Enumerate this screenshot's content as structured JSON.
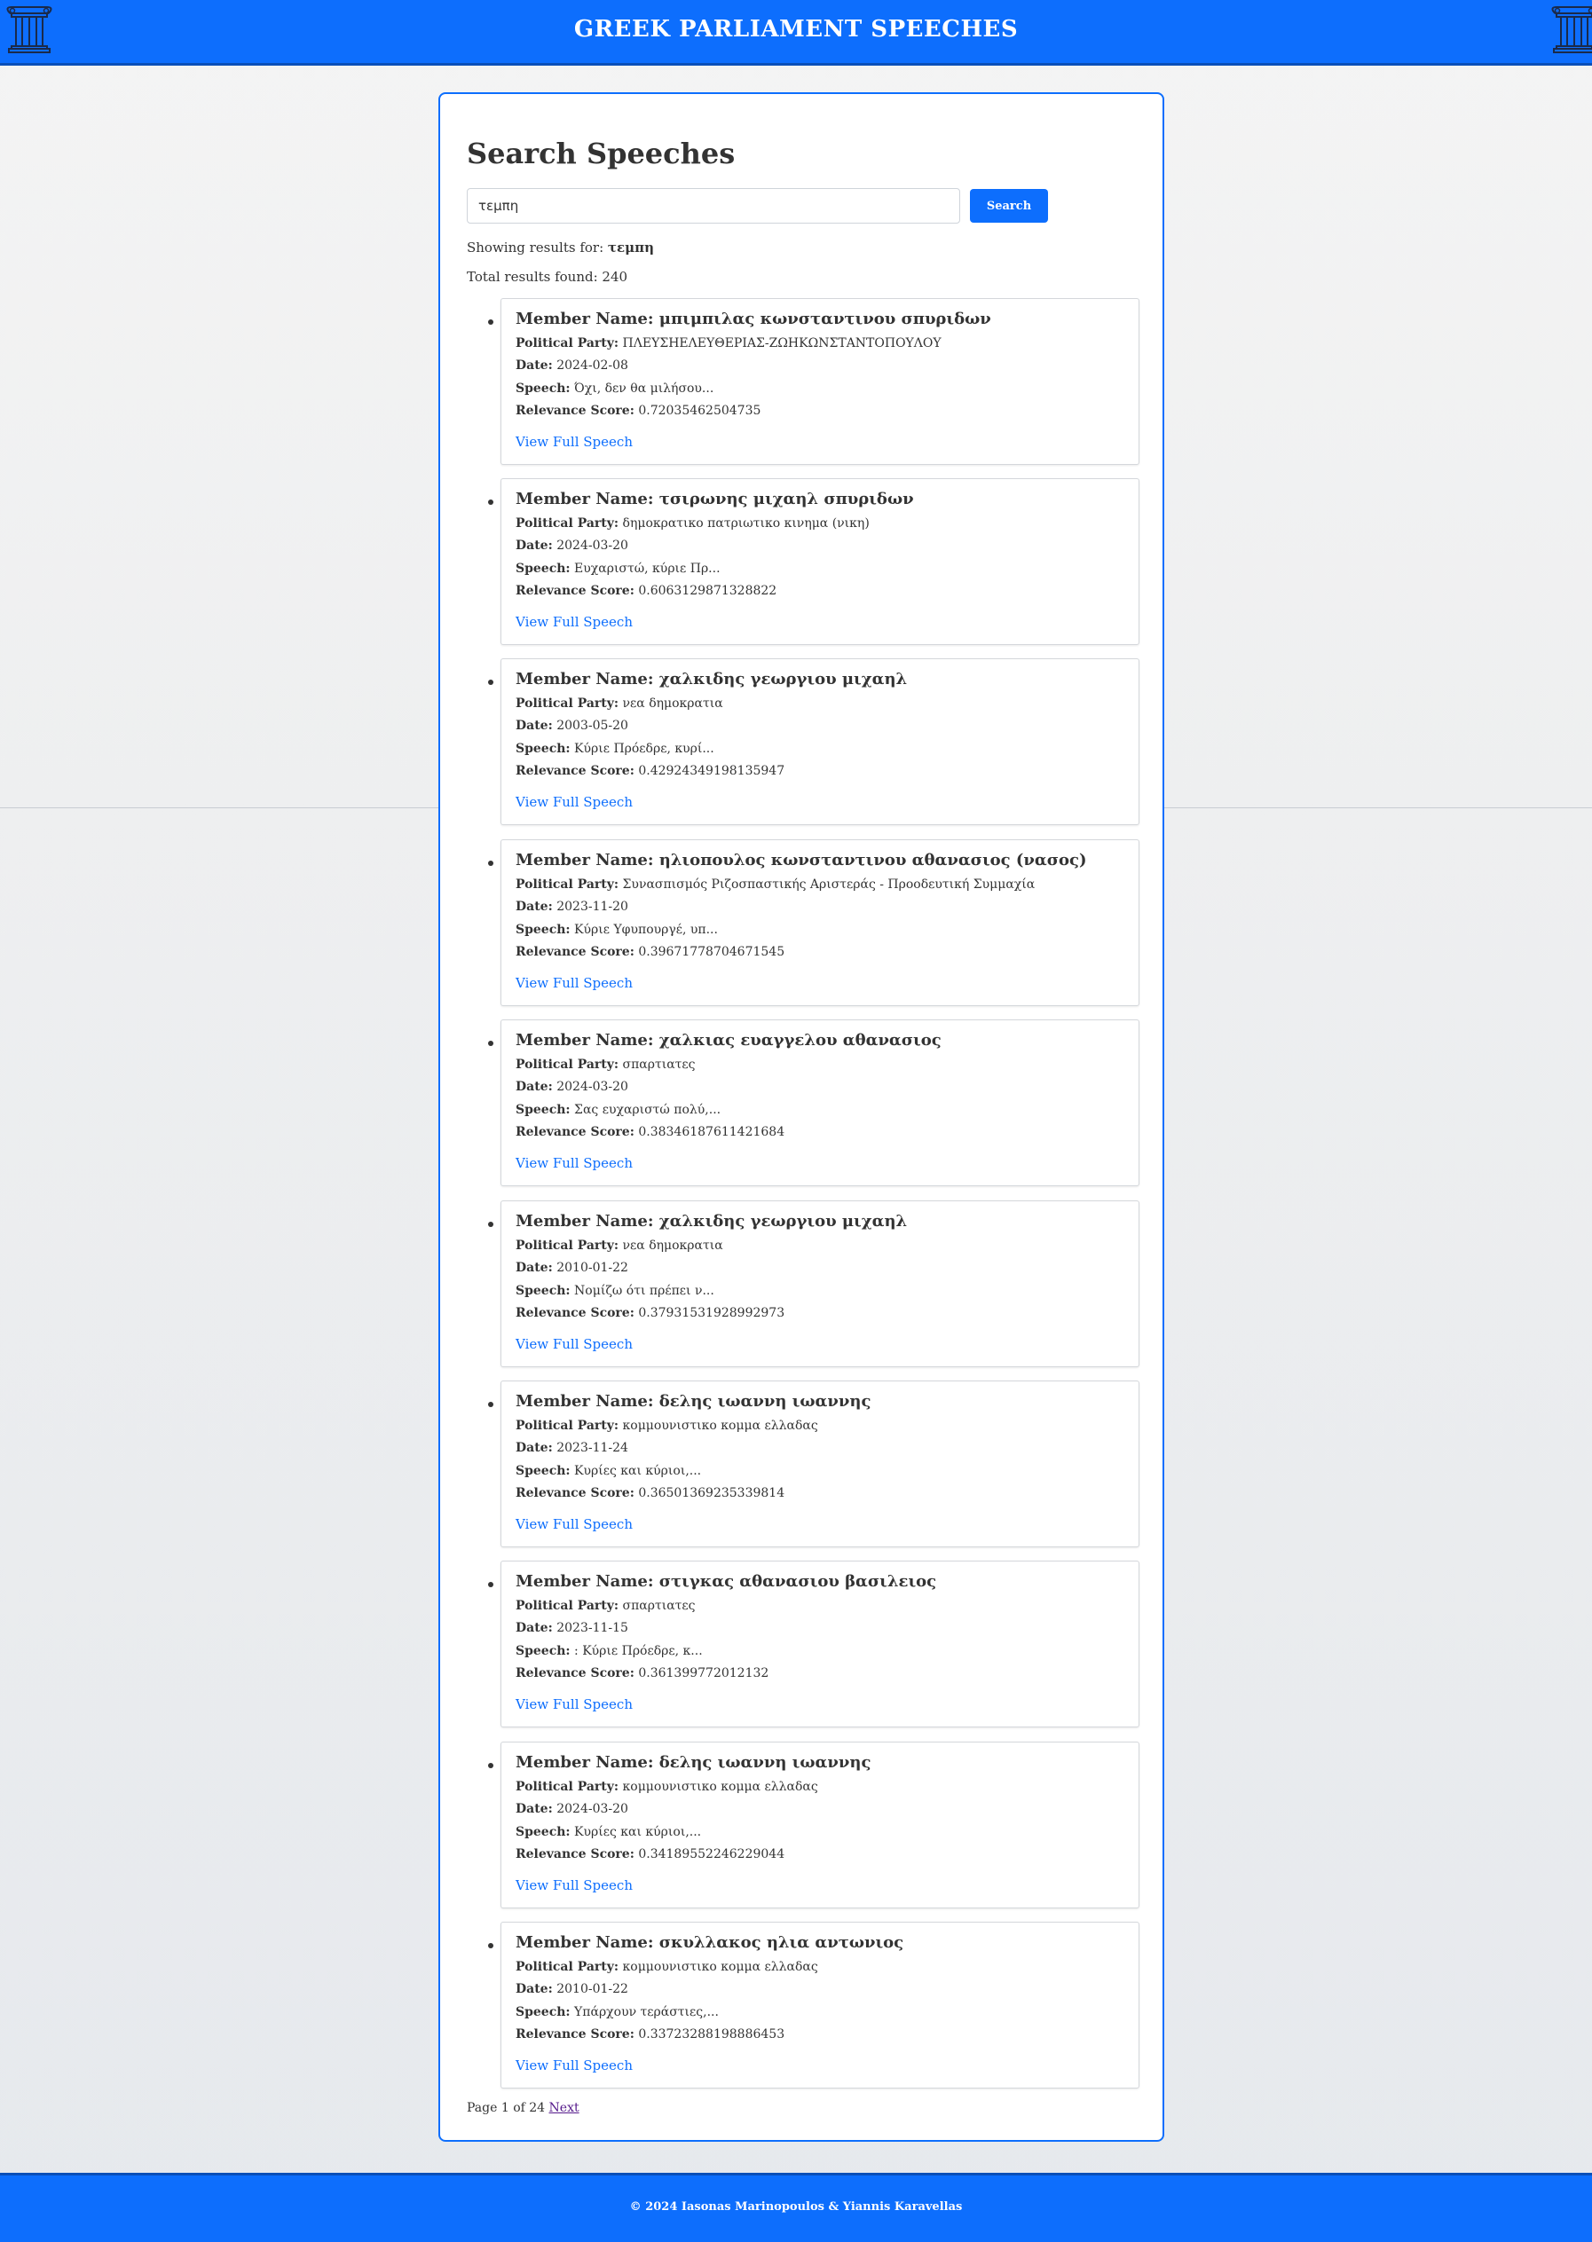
{
  "header": {
    "title": "GREEK PARLIAMENT SPEECHES"
  },
  "search": {
    "title": "Search Speeches",
    "query_value": "τεμπη",
    "button_label": "Search",
    "showing_prefix": "Showing results for:",
    "showing_query": "τεμπη",
    "total_text": "Total results found: 240"
  },
  "labels": {
    "member_name": "Member Name:",
    "political_party": "Political Party:",
    "date": "Date:",
    "speech": "Speech:",
    "relevance": "Relevance Score:",
    "view_full": "View Full Speech"
  },
  "results": [
    {
      "member": "μπιμπιλας κωνσταντινου σπυριδων",
      "party": "ΠΛΕΥΣΗΕΛΕΥΘΕΡΙΑΣ-ΖΩΗΚΩΝΣΤΑΝΤΟΠΟΥΛΟΥ",
      "date": "2024-02-08",
      "speech": "Όχι, δεν θα μιλήσου...",
      "score": "0.7203546250473​5"
    },
    {
      "member": "τσιρωνης μιχαηλ σπυριδων",
      "party": "δημοκρατικο πατριωτικο κινημα (νικη)",
      "date": "2024-03-20",
      "speech": "Ευχαριστώ, κύριε Πρ...",
      "score": "0.6063129871328822"
    },
    {
      "member": "χαλκιδης γεωργιου μιχαηλ",
      "party": "νεα δημοκρατια",
      "date": "2003-05-20",
      "speech": "Κύριε Πρόεδρε, κυρί...",
      "score": "0.42924349198135947"
    },
    {
      "member": "ηλιοπουλος κωνσταντινου αθανασιος (νασος)",
      "party": "Συνασπισμός Ριζοσπαστικής Αριστεράς - Προοδευτική Συμμαχία",
      "date": "2023-11-20",
      "speech": "Κύριε Υφυπουργέ, υπ...",
      "score": "0.39671778704671545"
    },
    {
      "member": "χαλκιας ευαγγελου αθανασιος",
      "party": "σπαρτιατες",
      "date": "2024-03-20",
      "speech": "Σας ευχαριστώ πολύ,...",
      "score": "0.3834618761142168​4"
    },
    {
      "member": "χαλκιδης γεωργιου μιχαηλ",
      "party": "νεα δημοκρατια",
      "date": "2010-01-22",
      "speech": "Νομίζω ότι πρέπει ν...",
      "score": "0.37931531928992973"
    },
    {
      "member": "δελης ιωαννη ιωαννης",
      "party": "κομμουνιστικο κομμα ελλαδας",
      "date": "2023-11-24",
      "speech": "Κυρίες και κύριοι,...",
      "score": "0.36501369235339814"
    },
    {
      "member": "στιγκας αθανασιου βασιλειος",
      "party": "σπαρτιατες",
      "date": "2023-11-15",
      "speech": ": Κύριε Πρόεδρε, κ...",
      "score": "0.361399772012132"
    },
    {
      "member": "δελης ιωαννη ιωαννης",
      "party": "κομμουνιστικο κομμα ελλαδας",
      "date": "2024-03-20",
      "speech": "Κυρίες και κύριοι,...",
      "score": "0.3418955224622904​4"
    },
    {
      "member": "σκυλλακος ηλια αντωνιος",
      "party": "κομμουνιστικο κομμα ελλαδας",
      "date": "2010-01-22",
      "speech": "Υπάρχουν τεράστιες,...",
      "score": "0.3372328819888645​3"
    }
  ],
  "pagination": {
    "text": "Page 1 of 24",
    "next_label": "Next"
  },
  "footer": {
    "text": "© 2024 Iasonas Marinopoulos & Yiannis Karavellas"
  },
  "icons": {
    "logo_left": "greek-column-icon",
    "logo_right": "greek-column-icon"
  },
  "colors": {
    "primary": "#0d6efd",
    "text": "#333333",
    "card_border": "#d4d7db"
  }
}
